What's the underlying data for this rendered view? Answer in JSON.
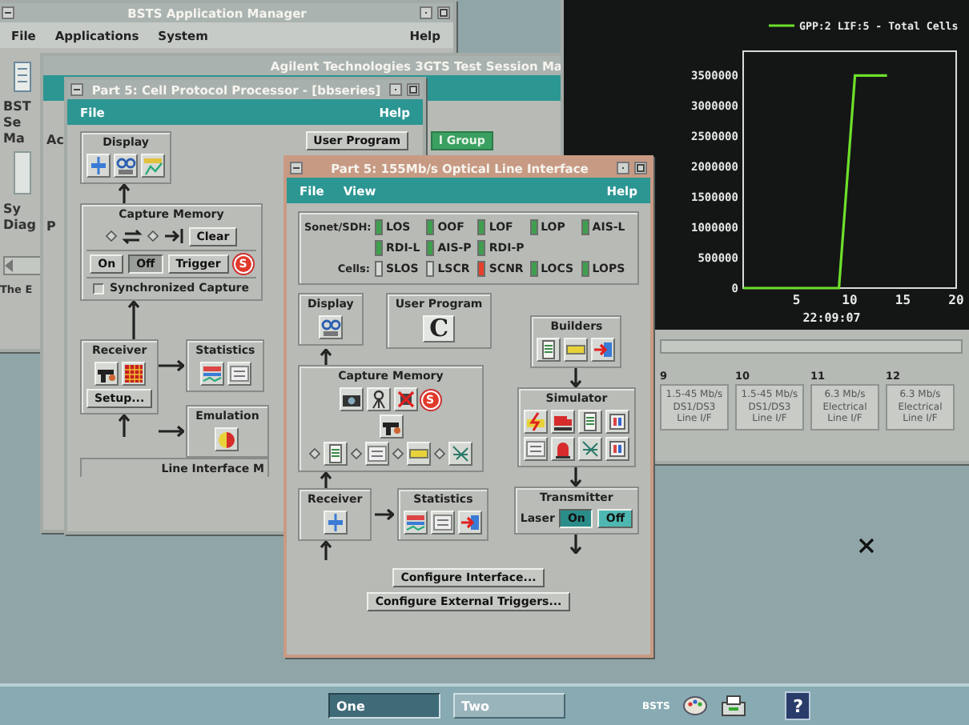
{
  "app_manager": {
    "title": "BSTS Application Manager",
    "menu": [
      "File",
      "Applications",
      "System"
    ],
    "help": "Help",
    "side_labels_top": [
      "BST",
      "Se",
      "Ma"
    ],
    "side_labels_mid": [
      "Sy",
      "Diag"
    ],
    "side_label_bottom": "The E"
  },
  "session_window": {
    "title": "Agilent Technologies 3GTS Test Session Ma",
    "side_labels": [
      "Ac",
      "P"
    ],
    "group_button": "l Group"
  },
  "cell_processor": {
    "title": "Part 5:  Cell Protocol Processor - [bbseries]",
    "menu": [
      "File"
    ],
    "help": "Help",
    "display": "Display",
    "user_program": "User Program",
    "capture_memory": {
      "title": "Capture Memory",
      "clear": "Clear",
      "modes": [
        {
          "label": "On",
          "selected": false
        },
        {
          "label": "Off",
          "selected": true
        }
      ],
      "trigger": "Trigger",
      "badge": "S",
      "sync": {
        "label": "Synchronized Capture",
        "checked": false
      }
    },
    "receiver": "Receiver",
    "setup": "Setup...",
    "statistics": "Statistics",
    "emulation": "Emulation",
    "line_interface": "Line Interface M"
  },
  "chart_window": {
    "chart_data": {
      "type": "line",
      "x": [
        0,
        9,
        10.5,
        13.5
      ],
      "series": [
        {
          "name": "GPP:2 LIF:5 - Total Cells",
          "color": "#6ee02a",
          "values": [
            0,
            0,
            3500000,
            3500000
          ]
        }
      ],
      "xlabel": "22:09:07",
      "xlim": [
        0,
        20
      ],
      "ylim": [
        0,
        3900000
      ],
      "xticks": [
        5,
        10,
        15,
        20
      ],
      "yticks": [
        0,
        500000,
        1000000,
        1500000,
        2000000,
        2500000,
        3000000,
        3500000
      ]
    },
    "cards": [
      {
        "number": "9",
        "lines": [
          "1.5-45 Mb/s",
          "DS1/DS3",
          "Line I/F"
        ]
      },
      {
        "number": "10",
        "lines": [
          "1.5-45 Mb/s",
          "DS1/DS3",
          "Line I/F"
        ]
      },
      {
        "number": "11",
        "lines": [
          "6.3 Mb/s",
          "Electrical",
          "Line I/F"
        ]
      },
      {
        "number": "12",
        "lines": [
          "6.3 Mb/s",
          "Electrical",
          "Line I/F"
        ]
      }
    ]
  },
  "optical_interface": {
    "title": "Part 5: 155Mb/s Optical Line Interface",
    "menu": [
      "File",
      "View"
    ],
    "help": "Help",
    "alarm_rows": [
      {
        "label": "Sonet/SDH:",
        "items": [
          {
            "label": "LOS",
            "color": "#3f9f4f"
          },
          {
            "label": "OOF",
            "color": "#3f9f4f"
          },
          {
            "label": "LOF",
            "color": "#3f9f4f"
          },
          {
            "label": "LOP",
            "color": "#3f9f4f"
          },
          {
            "label": "AIS-L",
            "color": "#3f9f4f"
          }
        ]
      },
      {
        "items": [
          {
            "label": "RDI-L",
            "color": "#3f9f4f"
          },
          {
            "label": "AIS-P",
            "color": "#3f9f4f"
          },
          {
            "label": "RDI-P",
            "color": "#3f9f4f"
          }
        ]
      },
      {
        "label": "Cells:",
        "items": [
          {
            "label": "SLOS",
            "color": "#d6d8d4"
          },
          {
            "label": "LSCR",
            "color": "#d6d8d4"
          },
          {
            "label": "SCNR",
            "color": "#e8402c"
          },
          {
            "label": "LOCS",
            "color": "#3f9f4f"
          },
          {
            "label": "LOPS",
            "color": "#3f9f4f"
          }
        ]
      }
    ],
    "display": "Display",
    "user_program": {
      "title": "User Program",
      "glyph": "C"
    },
    "builders": "Builders",
    "capture_memory": {
      "title": "Capture Memory",
      "badge": "S"
    },
    "simulator": "Simulator",
    "receiver": "Receiver",
    "statistics": "Statistics",
    "transmitter": {
      "title": "Transmitter",
      "label": "Laser",
      "options": [
        {
          "label": "On",
          "selected": true
        },
        {
          "label": "Off",
          "selected": false
        }
      ]
    },
    "buttons": [
      "Configure Interface...",
      "Configure External Triggers..."
    ]
  },
  "taskbar": {
    "workspaces": [
      {
        "label": "One",
        "selected": true
      },
      {
        "label": "Two",
        "selected": false
      }
    ],
    "app_label": "BSTS",
    "help": "?"
  }
}
